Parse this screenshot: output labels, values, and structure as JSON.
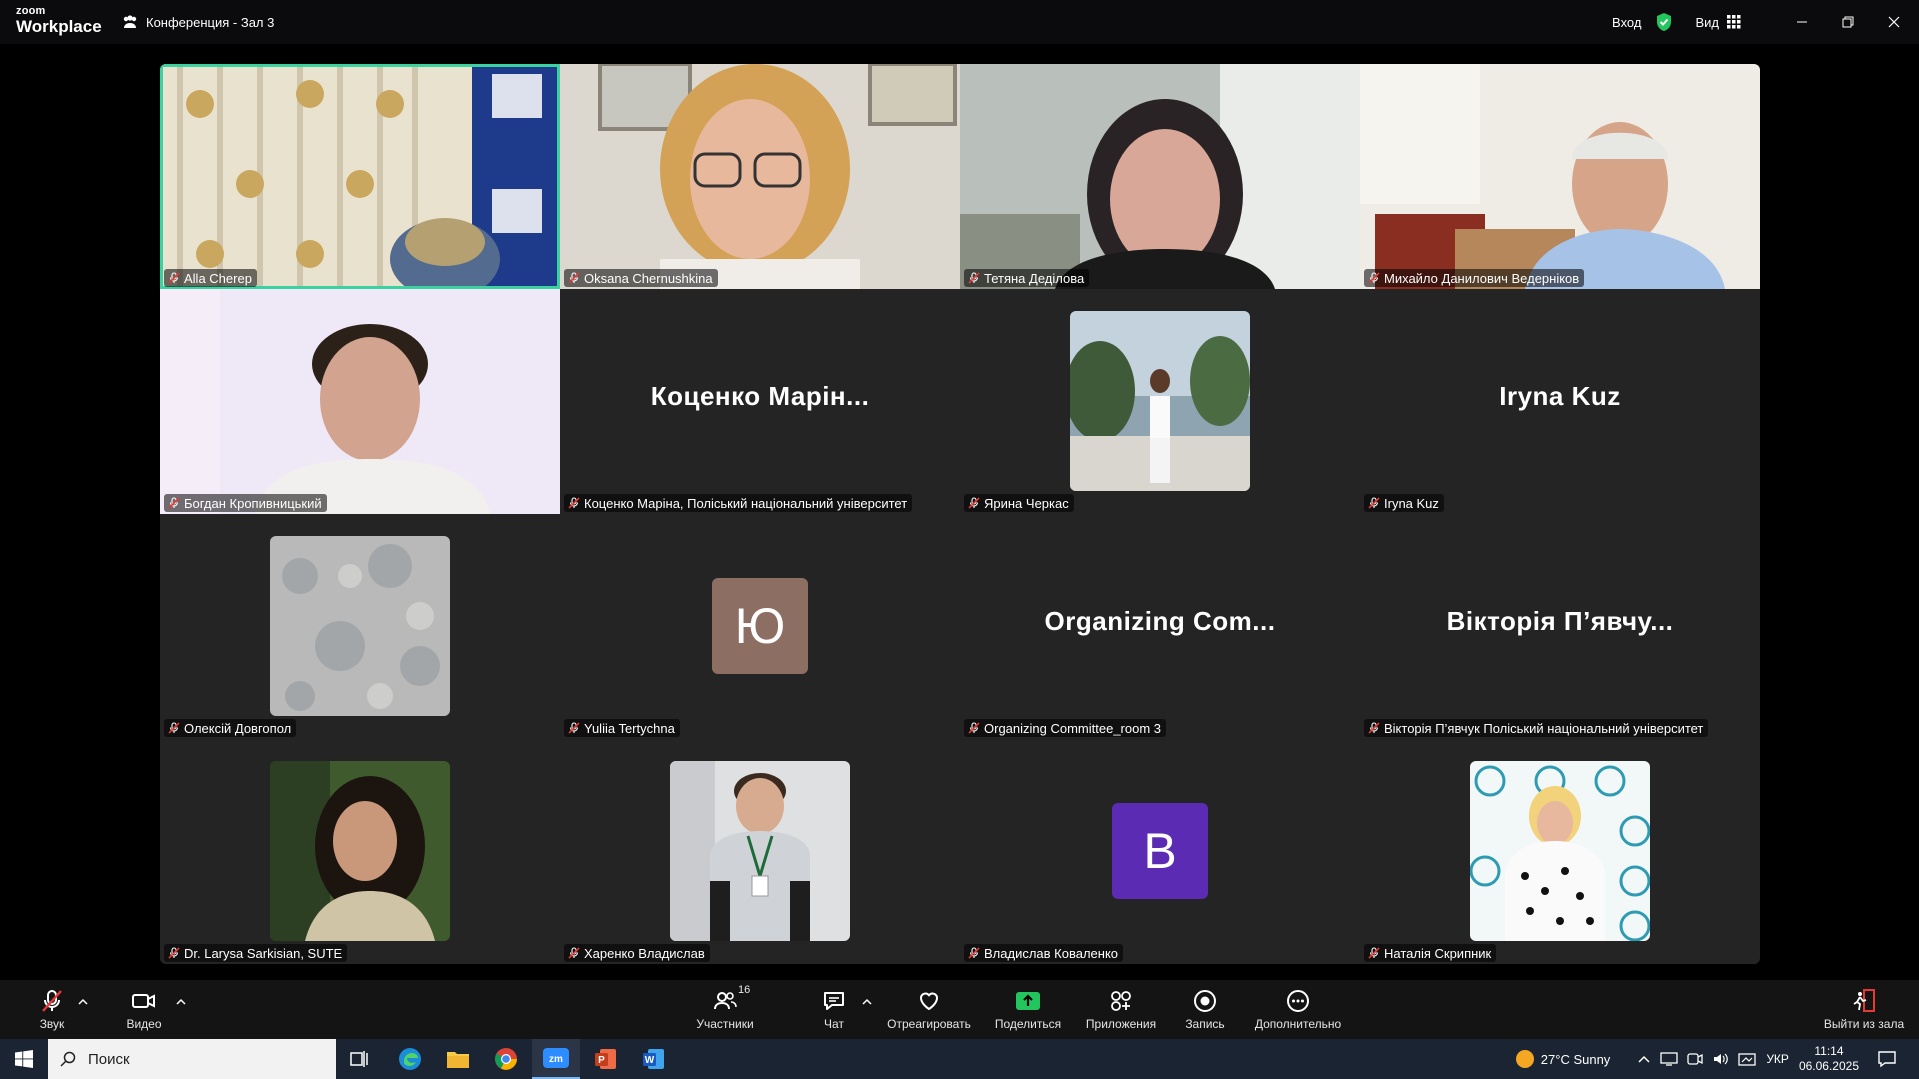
{
  "app": {
    "logo_line1": "zoom",
    "logo_line2": "Workplace",
    "room_title": "Конференция - Зал 3"
  },
  "titlebar": {
    "signin_label": "Вход",
    "view_label": "Вид"
  },
  "participants": [
    {
      "name": "Alla Cherep",
      "type": "video",
      "scene": "curtain",
      "active": true
    },
    {
      "name": "Oksana Chernushkina",
      "type": "video",
      "scene": "woman-glasses"
    },
    {
      "name": "Тетяна Деділова",
      "type": "video",
      "scene": "woman-dark"
    },
    {
      "name": "Михайло Данилович Ведерніков",
      "type": "video",
      "scene": "older-man"
    },
    {
      "name": "Богдан Кропивницький",
      "type": "video",
      "scene": "young-man"
    },
    {
      "name": "Коценко Маріна, Поліський національний університет",
      "type": "name",
      "display": "Коценко Марін..."
    },
    {
      "name": "Ярина Черкас",
      "type": "photo",
      "scene": "seaside"
    },
    {
      "name": "Iryna Kuz",
      "type": "name",
      "display": "Iryna Kuz"
    },
    {
      "name": "Олексій Довгопол",
      "type": "photo",
      "scene": "stone"
    },
    {
      "name": "Yuliia Tertychna",
      "type": "letter",
      "letter": "Ю",
      "color": "#8d6e63"
    },
    {
      "name": "Organizing Committee_room 3",
      "type": "name",
      "display": "Organizing Com..."
    },
    {
      "name": "Вікторія П’явчук Поліський національний університет",
      "type": "name",
      "display": "Вікторія П’явчу..."
    },
    {
      "name": "Dr. Larysa Sarkisian, SUTE",
      "type": "photo",
      "scene": "woman-curly"
    },
    {
      "name": "Харенко Владислав",
      "type": "photo",
      "scene": "man-badge"
    },
    {
      "name": "Владислав Коваленко",
      "type": "letter",
      "letter": "В",
      "color": "#5b2bb3"
    },
    {
      "name": "Наталія Скрипник",
      "type": "photo",
      "scene": "woman-banner"
    }
  ],
  "toolbar": {
    "audio_label": "Звук",
    "video_label": "Видео",
    "participants_label": "Участники",
    "participants_count": "16",
    "chat_label": "Чат",
    "react_label": "Отреагировать",
    "share_label": "Поделиться",
    "apps_label": "Приложения",
    "record_label": "Запись",
    "more_label": "Дополнительно",
    "leave_label": "Выйти из зала"
  },
  "taskbar": {
    "search_placeholder": "Поиск",
    "weather": "27°C  Sunny",
    "language": "УКР",
    "time": "11:14",
    "date": "06.06.2025"
  },
  "colors": {
    "active_border": "#3ad29f",
    "share_green": "#22c55e",
    "shield_green": "#22c55e"
  }
}
